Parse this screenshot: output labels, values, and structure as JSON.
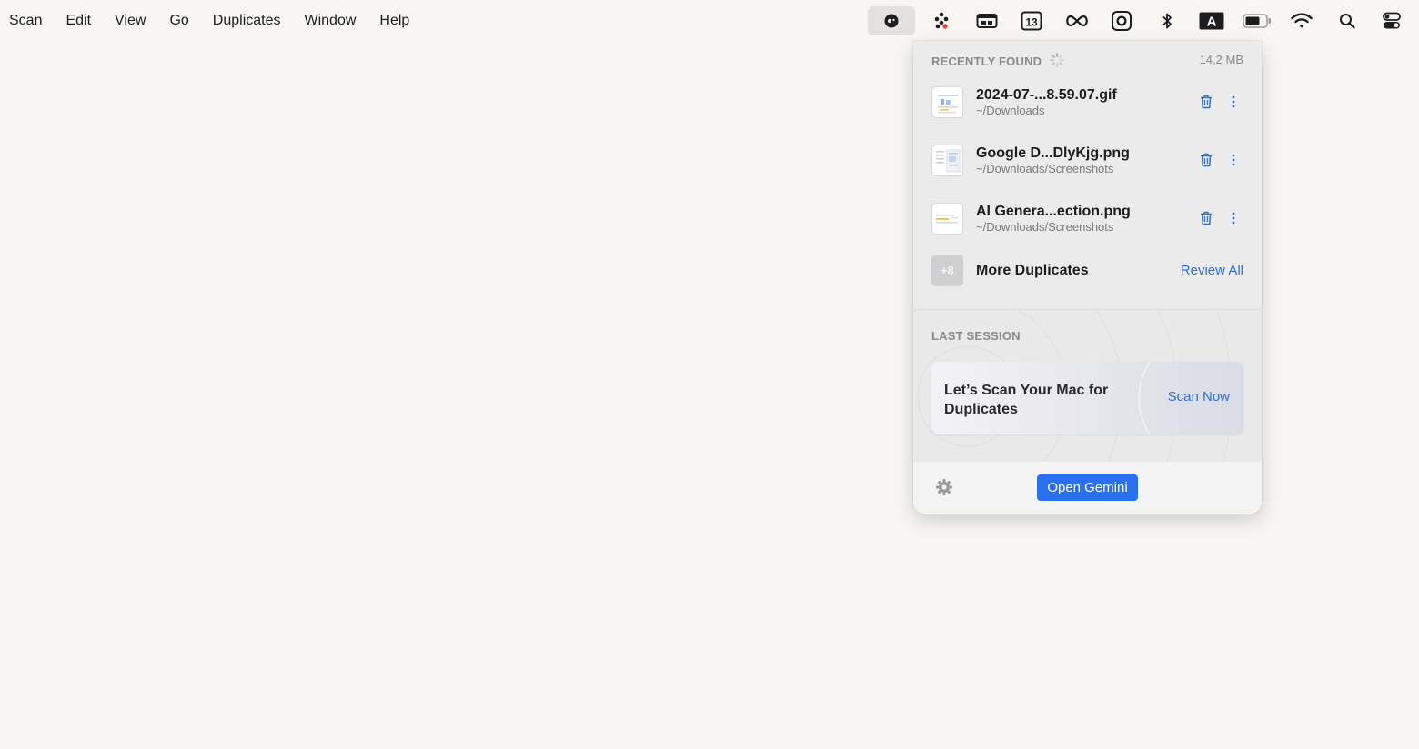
{
  "menubar": {
    "menus": [
      "Scan",
      "Edit",
      "View",
      "Go",
      "Duplicates",
      "Window",
      "Help"
    ],
    "status_icons": [
      "gemini-app-icon",
      "dots-app-icon",
      "display-icon",
      "calendar-13-icon",
      "infinity-icon",
      "screenshot-icon",
      "bluetooth-icon",
      "keyboard-a-icon",
      "battery-icon",
      "wifi-icon",
      "search-icon",
      "control-center-icon"
    ],
    "calendar_day": "13",
    "keyboard_letter": "A"
  },
  "panel": {
    "recent_title": "RECENTLY FOUND",
    "total_size": "14,2 MB",
    "files": [
      {
        "name": "2024-07-...8.59.07.gif",
        "path": "~/Downloads"
      },
      {
        "name": "Google D...DlyKjg.png",
        "path": "~/Downloads/Screenshots"
      },
      {
        "name": "AI Genera...ection.png",
        "path": "~/Downloads/Screenshots"
      }
    ],
    "more": {
      "badge": "+8",
      "label": "More Duplicates",
      "link": "Review All"
    },
    "last_session_title": "LAST SESSION",
    "scan_card": {
      "text": "Let’s Scan Your Mac for Duplicates",
      "action": "Scan Now"
    },
    "open_button": "Open Gemini"
  },
  "colors": {
    "accent": "#2a6ff0",
    "link": "#2f6fdb",
    "trash": "#2f6fdb",
    "background": "#f8f6f2"
  }
}
